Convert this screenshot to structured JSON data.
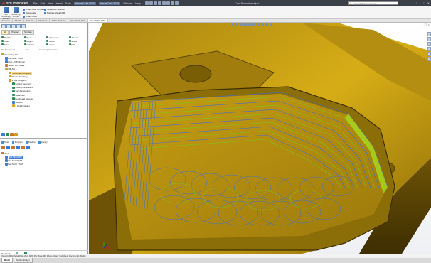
{
  "app": {
    "logo": "SOLIDWORKS",
    "doc_title": "Cam Perimeter.sldprt *",
    "search_placeholder": "Search Solidworks Help"
  },
  "menu": [
    "File",
    "Edit",
    "View",
    "Insert",
    "Tools",
    "VisualCAM 2023",
    "VisualCAM 2023",
    "Window",
    "Help"
  ],
  "ribbon": {
    "big_buttons": [
      {
        "label": "Set Machining Defaults"
      },
      {
        "label": "Machining Browser"
      }
    ],
    "small_buttons": [
      "Create Post Templates",
      "Regenerate",
      "Create Code",
      "VisualCAM Settings",
      "Machine VisualCAM"
    ]
  },
  "tabs": [
    "Features",
    "Sketch",
    "Evaluate",
    "DimXpert",
    "Office Products",
    "VisualCAM 2023",
    "VisualCAM 2023"
  ],
  "active_tab": "VisualCAM 2023",
  "cam_tabs": [
    "Mill",
    "Program",
    "Simulate"
  ],
  "cam_tools": [
    [
      "Machine",
      "Stock",
      "Work Zone",
      "2½ Axis"
    ],
    [
      "Tools",
      "Regen",
      "3 Axis",
      "5 Axis"
    ],
    [
      "Setup",
      "Material",
      "4 Axis",
      "Drill"
    ]
  ],
  "cam_tool_groups": [
    "Machining Setup",
    "Tools",
    "Machining Operations"
  ],
  "tree": [
    {
      "label": "Machining Job",
      "indent": 0,
      "color": "#d99a1e"
    },
    {
      "label": "Machine - 3 Axis",
      "indent": 1,
      "color": "#3a7bd5"
    },
    {
      "label": "Post - VMS/Fanuc",
      "indent": 1,
      "color": "#3a7bd5"
    },
    {
      "label": "Stock - Box Stock",
      "indent": 1,
      "color": "#c8762b"
    },
    {
      "label": "Mill-Set 1",
      "indent": 1,
      "color": "#d99a1e"
    },
    {
      "label": "Horizontal Roughing",
      "indent": 2,
      "color": "#d99a1e",
      "selected": true
    },
    {
      "label": "Parallel Finishing",
      "indent": 2,
      "color": "#d99a1e"
    },
    {
      "label": "3 Axis Roughing",
      "indent": 2,
      "color": "#d99a1e"
    },
    {
      "label": "Control Geometry",
      "indent": 3,
      "color": "#2e8b57"
    },
    {
      "label": "Cutting Parameters",
      "indent": 3,
      "color": "#2e8b57"
    },
    {
      "label": "Tool Parameters",
      "indent": 3,
      "color": "#2e8b57"
    },
    {
      "label": "Clearance",
      "indent": 3,
      "color": "#2e8b57"
    },
    {
      "label": "Feeds and Speeds",
      "indent": 3,
      "color": "#2e8b57"
    },
    {
      "label": "Toolpath",
      "indent": 3,
      "color": "#3a7bd5"
    },
    {
      "label": "3 Axis Finishing",
      "indent": 3,
      "color": "#e0a020"
    }
  ],
  "lower_tabs": [
    "Tools",
    "Program",
    "Feature",
    "Library"
  ],
  "tools_tree": [
    {
      "label": "Tools",
      "indent": 0,
      "color": "#c8762b"
    },
    {
      "label": "Ball Mill 8 MM",
      "indent": 1,
      "color": "#3a7bd5",
      "selected": true
    },
    {
      "label": "Flat Mill 10 MM",
      "indent": 1,
      "color": "#3a7bd5"
    },
    {
      "label": "Ball Mill 2.7 MM",
      "indent": 1,
      "color": "#3a7bd5"
    }
  ],
  "left_bottom": {
    "label": "Tab Stock"
  },
  "status": "VisualCAM for SolidWorks 2022 ANSI Pro Mode: Mill 3 Axis (Rotary Undefined) Document 1: Model",
  "bottom_tabs": [
    "Model",
    "Motion Study 1"
  ],
  "colors": {
    "part_gold": "#c59a12",
    "toolpath_blue": "#3a6fd8",
    "toolpath_green": "#7cc81a"
  }
}
